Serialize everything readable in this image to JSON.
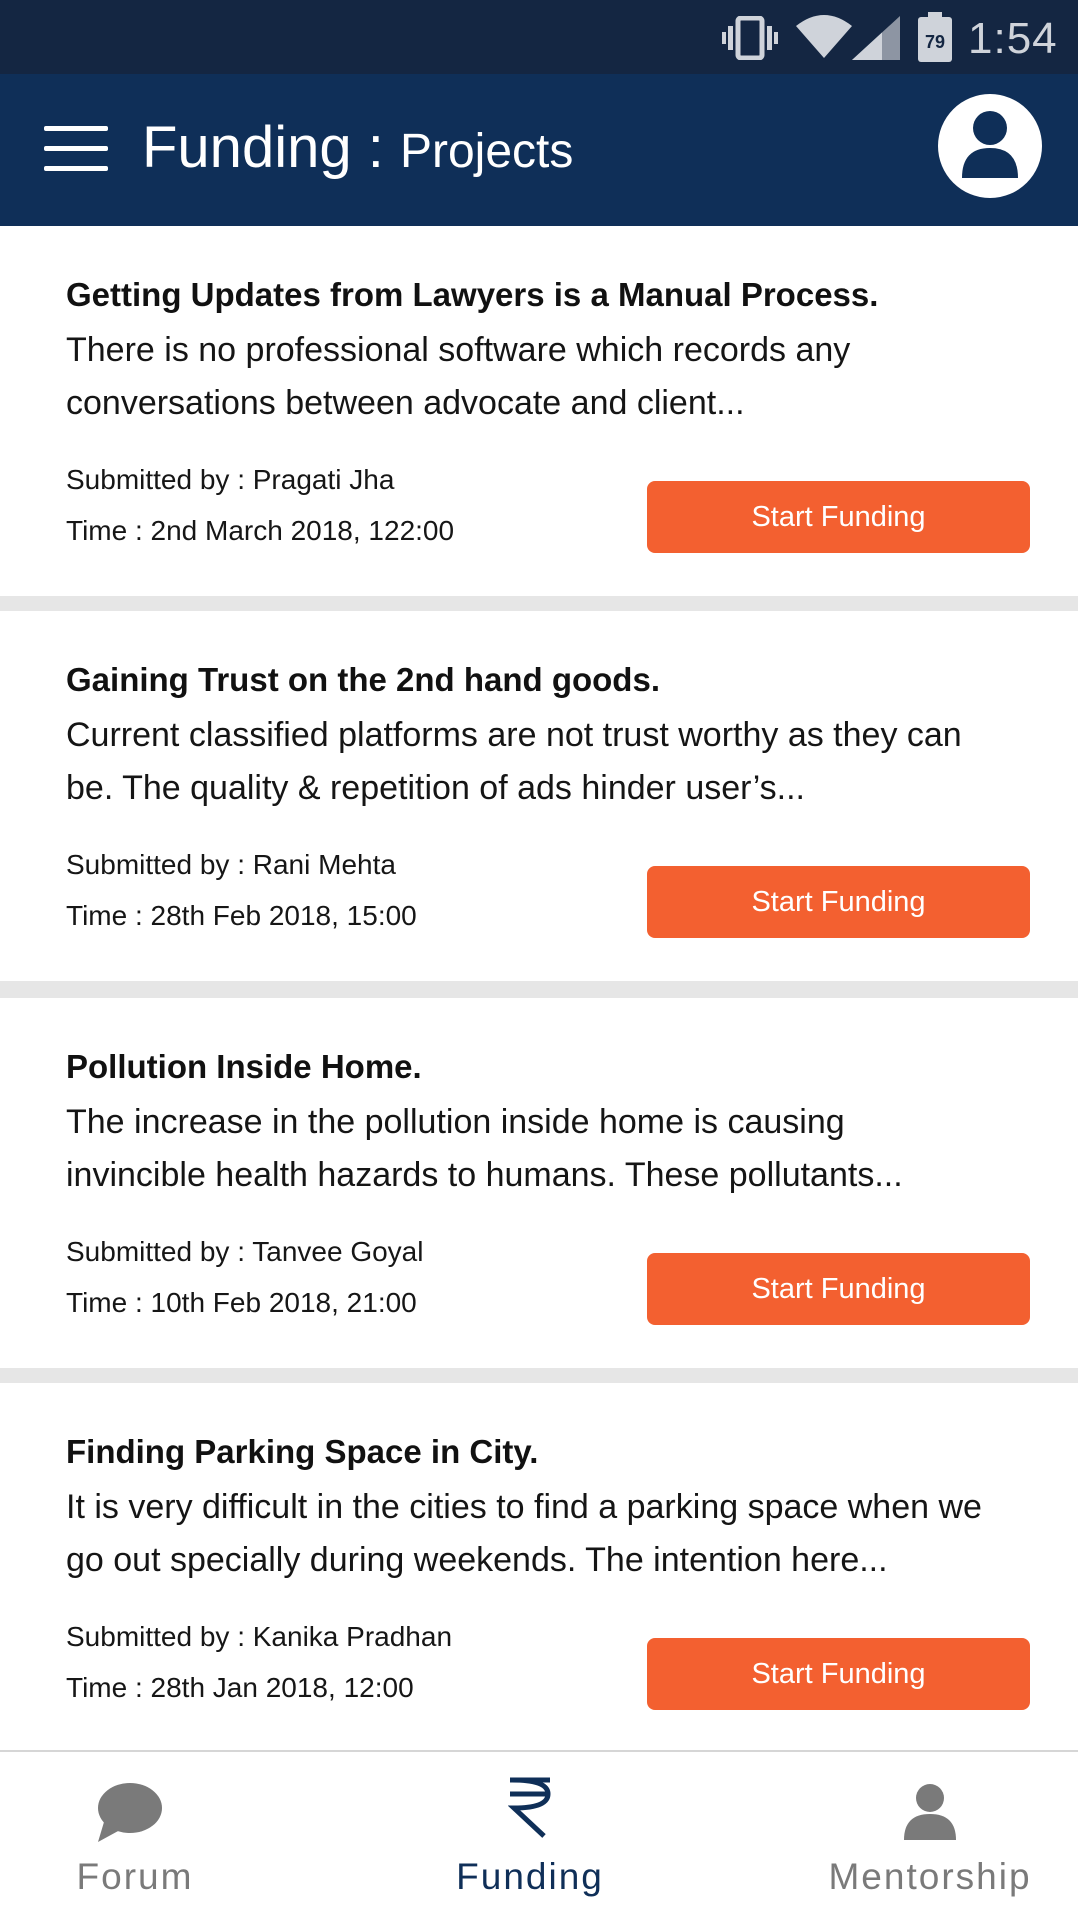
{
  "status_bar": {
    "battery_level": "79",
    "time": "1:54",
    "icons": [
      "vibrate-icon",
      "wifi-icon",
      "cell-signal-icon",
      "battery-icon"
    ]
  },
  "app_bar": {
    "title_main": "Funding",
    "title_separator": " : ",
    "title_sub": "Projects",
    "icons": [
      "hamburger-menu-icon",
      "profile-icon"
    ]
  },
  "projects": [
    {
      "title": "Getting Updates from Lawyers is a Manual Process.",
      "description": "There is no professional software which records any\nconversations between advocate and client...",
      "submitted_by": "Submitted by : Pragati Jha",
      "time": "Time : 2nd March 2018, 122:00",
      "button_label": "Start Funding"
    },
    {
      "title": "Gaining Trust on the 2nd hand goods.",
      "description": "Current classified platforms are not trust worthy as they can\nbe. The quality & repetition of ads hinder user’s...",
      "submitted_by": "Submitted by : Rani Mehta",
      "time": "Time : 28th Feb 2018, 15:00",
      "button_label": "Start Funding"
    },
    {
      "title": "Pollution Inside Home.",
      "description": "The increase in the pollution inside home is causing\n invincible health hazards to humans. These pollutants...",
      "submitted_by": "Submitted by : Tanvee Goyal",
      "time": "Time : 10th Feb 2018, 21:00",
      "button_label": "Start Funding"
    },
    {
      "title": "Finding Parking Space in City.",
      "description": "It is very difficult in the cities to find a parking space when we\ngo out specially during weekends. The intention here...",
      "submitted_by": "Submitted by : Kanika Pradhan",
      "time": "Time : 28th Jan 2018, 12:00",
      "button_label": "Start Funding"
    }
  ],
  "bottom_nav": {
    "items": [
      {
        "label": "Forum",
        "icon": "chat-bubble-icon",
        "active": false
      },
      {
        "label": "Funding",
        "icon": "rupee-icon",
        "active": true
      },
      {
        "label": "Mentorship",
        "icon": "person-icon",
        "active": false
      }
    ]
  },
  "colors": {
    "status_bar": "#142642",
    "app_bar": "#0f2f58",
    "button": "#f36030",
    "nav_active": "#0f2f58",
    "nav_inactive": "#7a7a7a",
    "card_separator": "#e6e6e6"
  }
}
